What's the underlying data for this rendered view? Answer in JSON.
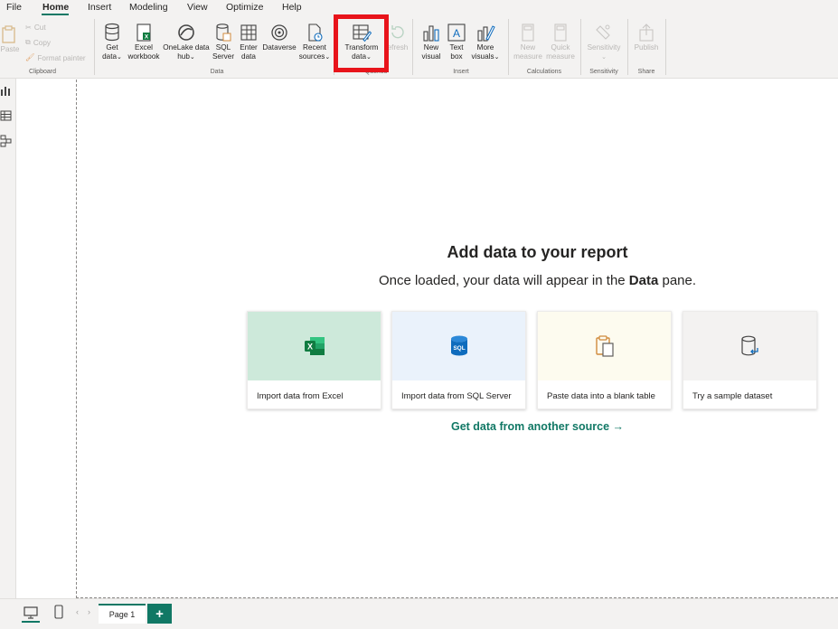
{
  "menu": {
    "items": [
      "File",
      "Home",
      "Insert",
      "Modeling",
      "View",
      "Optimize",
      "Help"
    ],
    "active": "Home"
  },
  "ribbon": {
    "clipboard": {
      "paste": "Paste",
      "cut": "Cut",
      "copy": "Copy",
      "format_painter": "Format painter",
      "label": "Clipboard"
    },
    "data": {
      "get_data": [
        "Get",
        "data"
      ],
      "excel": [
        "Excel",
        "workbook"
      ],
      "onelake": [
        "OneLake data",
        "hub"
      ],
      "sql": [
        "SQL",
        "Server"
      ],
      "enter": [
        "Enter",
        "data"
      ],
      "dataverse": "Dataverse",
      "recent": [
        "Recent",
        "sources"
      ],
      "label": "Data"
    },
    "queries": {
      "transform": [
        "Transform",
        "data"
      ],
      "refresh": "efresh",
      "label": "Queries"
    },
    "insert": {
      "new_visual": [
        "New",
        "visual"
      ],
      "text_box": [
        "Text",
        "box"
      ],
      "more_visuals": [
        "More",
        "visuals"
      ],
      "label": "Insert"
    },
    "calculations": {
      "new_measure": [
        "New",
        "measure"
      ],
      "quick_measure": [
        "Quick",
        "measure"
      ],
      "label": "Calculations"
    },
    "sensitivity": {
      "button": "Sensitivity",
      "label": "Sensitivity"
    },
    "share": {
      "button": "Publish",
      "label": "Share"
    }
  },
  "canvas": {
    "title": "Add data to your report",
    "subtitle_before": "Once loaded, your data will appear in the ",
    "subtitle_bold": "Data",
    "subtitle_after": " pane.",
    "cards": [
      {
        "label": "Import data from Excel",
        "icon": "excel-icon",
        "bg": "#cde9da"
      },
      {
        "label": "Import data from SQL Server",
        "icon": "sql-server-icon",
        "bg": "#eaf2fb"
      },
      {
        "label": "Paste data into a blank table",
        "icon": "paste-icon",
        "bg": "#fdfbef"
      },
      {
        "label": "Try a sample dataset",
        "icon": "database-icon",
        "bg": "#f3f2f1"
      }
    ],
    "get_more": "Get data from another source →"
  },
  "pages": {
    "tab": "Page 1",
    "add": "+"
  },
  "colors": {
    "accent": "#117865",
    "highlight": "#e8141b",
    "ribbon_bg": "#f3f2f1"
  }
}
